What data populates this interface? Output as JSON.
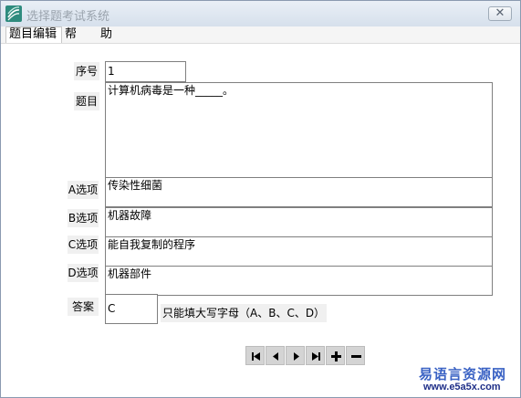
{
  "window": {
    "title": "选择题考试系统",
    "close_label": "✕"
  },
  "menu": {
    "items": [
      "题目编辑",
      "帮　　助"
    ]
  },
  "form": {
    "seq_label": "序号",
    "seq_value": "1",
    "question_label": "题目",
    "question_value": "计算机病毒是一种_____。",
    "option_a_label": "A选项",
    "option_a_value": "传染性细菌",
    "option_b_label": "B选项",
    "option_b_value": "机器故障",
    "option_c_label": "C选项",
    "option_c_value": "能自我复制的程序",
    "option_d_label": "D选项",
    "option_d_value": "机器部件",
    "answer_label": "答案",
    "answer_value": "C",
    "answer_hint": "只能填大写字母（A、B、C、D）"
  },
  "nav": {
    "icons": [
      "first-record-icon",
      "prev-record-icon",
      "next-record-icon",
      "last-record-icon",
      "add-record-icon",
      "delete-record-icon"
    ]
  },
  "watermark": {
    "brand": "易语言资源网",
    "url": "www.e5a5x.com"
  },
  "colors": {
    "titlebar": "#d6e0ec",
    "watermark": "#3a62c4",
    "app_icon": "#2e8b7e"
  }
}
